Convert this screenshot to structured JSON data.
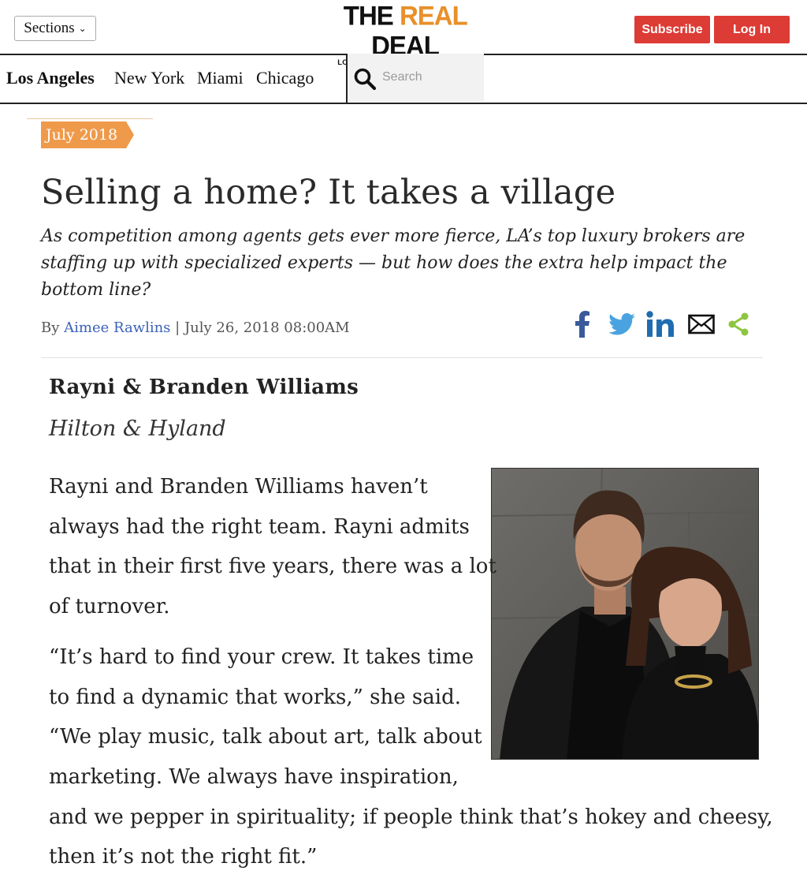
{
  "header": {
    "sections_label": "Sections",
    "logo": {
      "part1": "THE ",
      "part2": "REAL",
      "part3": " DEAL",
      "tagline": "LOS ANGELES REAL ESTATE NEWS"
    },
    "subscribe_label": "Subscribe",
    "login_label": "Log In",
    "accent_color": "#e8902a",
    "button_color": "#dd3b35"
  },
  "cities": [
    "Los Angeles",
    "New York",
    "Miami",
    "Chicago"
  ],
  "search": {
    "placeholder": "Search"
  },
  "article": {
    "issue_tag": "July 2018",
    "headline": "Selling a home? It takes a village",
    "dek": "As competition among agents gets ever more fierce, LA’s top luxury brokers are staffing up with specialized experts — but how does the extra help impact the bottom line?",
    "byline_prefix": "By ",
    "author": "Aimee Rawlins",
    "byline_separator": " | ",
    "date": "July 26, 2018 08:00AM",
    "share_icons": [
      "facebook-icon",
      "twitter-icon",
      "linkedin-icon",
      "email-icon",
      "share-icon"
    ],
    "profile": {
      "name": "Rayni & Branden Williams",
      "firm": "Hilton & Hyland",
      "paragraph1": [
        "Rayni and Branden Williams haven’t",
        "always had the right team. Rayni admits",
        "that in their first five years, there was a lot",
        "of turnover."
      ],
      "paragraph2": [
        "“It’s hard to find your crew. It takes time",
        "to find a dynamic that works,” she said.",
        "“We play music, talk about art, talk about",
        "marketing. We always have inspiration,",
        "and we pepper in spirituality; if people think that’s hokey and cheesy,",
        "then it’s not the right fit.”"
      ]
    }
  }
}
